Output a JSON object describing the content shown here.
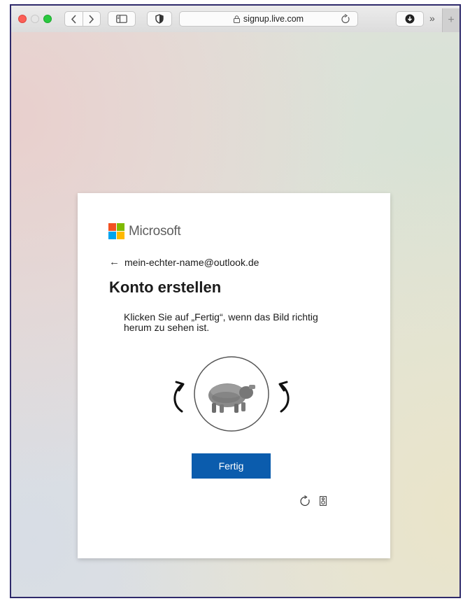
{
  "browser": {
    "url": "signup.live.com",
    "more_glyph": "»",
    "new_tab_glyph": "+"
  },
  "brand": {
    "name": "Microsoft",
    "colors": [
      "#f25022",
      "#7fba00",
      "#00a4ef",
      "#ffb900"
    ]
  },
  "signup": {
    "back_glyph": "←",
    "email": "mein-echter-name@outlook.de",
    "title": "Konto erstellen",
    "instruction": "Klicken Sie auf „Fertig“, wenn das Bild richtig herum zu sehen ist.",
    "done_button": "Fertig",
    "accent_color": "#0b5cad"
  },
  "icons": {
    "puzzle_left": "rotate-left-icon",
    "puzzle_right": "rotate-right-icon",
    "puzzle_image": "upside-down-animal-image",
    "reload": "reload-challenge-icon",
    "audio": "audio-challenge-icon"
  }
}
